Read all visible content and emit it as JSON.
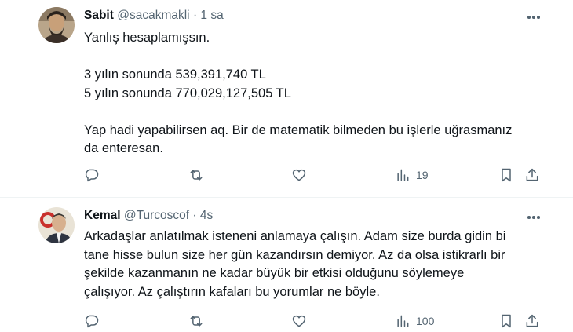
{
  "tweets": [
    {
      "name": "Sabit",
      "handle": "@sacakmakli",
      "separator": "·",
      "time": "1 sa",
      "lines": [
        "Yanlış hesaplamışsın.",
        "",
        "3 yılın sonunda 539,391,740 TL",
        "5 yılın sonunda 770,029,127,505 TL",
        "",
        "Yap hadi yapabilirsen aq. Bir de matematik bilmeden bu işlerle uğrasmanız",
        "da enteresan."
      ],
      "views": "19"
    },
    {
      "name": "Kemal",
      "handle": "@Turcoscof",
      "separator": "·",
      "time": "4s",
      "lines": [
        "Arkadaşlar anlatılmak isteneni anlamaya çalışın. Adam size burda gidin bi",
        "tane hisse bulun size her gün kazandırsın demiyor. Az da olsa istikrarlı bir",
        "şekilde kazanmanın ne kadar büyük bir etkisi olduğunu söylemeye",
        "çalışıyor. Az çalıştırın kafaları bu yorumlar ne böyle."
      ],
      "views": "100"
    }
  ],
  "icons": {
    "reply": "reply-icon",
    "retweet": "retweet-icon",
    "like": "like-icon",
    "views": "views-icon",
    "bookmark": "bookmark-icon",
    "share": "share-icon",
    "more": "more-icon"
  },
  "colors": {
    "text": "#0f1419",
    "secondary": "#536471",
    "divider": "#eff3f4"
  }
}
